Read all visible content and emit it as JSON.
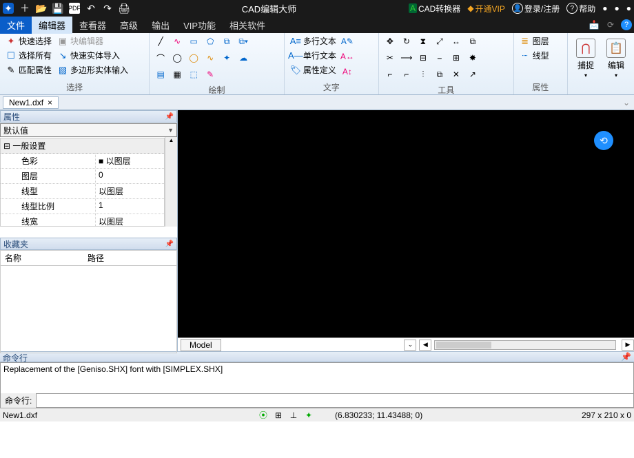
{
  "titlebar": {
    "appicon": "⟠",
    "title": "CAD编辑大师",
    "converter": "CAD转换器",
    "vip": "开通VIP",
    "login": "登录/注册",
    "help": "帮助"
  },
  "menus": {
    "file": "文件",
    "editor": "编辑器",
    "viewer": "查看器",
    "advanced": "高级",
    "output": "输出",
    "vip": "VIP功能",
    "related": "相关软件"
  },
  "ribbon": {
    "select": {
      "label": "选择",
      "quick": "快速选择",
      "blockedit": "块编辑器",
      "all": "选择所有",
      "quickimport": "快速实体导入",
      "match": "匹配属性",
      "polyinput": "多边形实体输入"
    },
    "draw": {
      "label": "绘制"
    },
    "text": {
      "label": "文字",
      "multi": "多行文本",
      "single": "单行文本",
      "attrdef": "属性定义"
    },
    "tools": {
      "label": "工具"
    },
    "props": {
      "label": "属性",
      "layer": "图层",
      "linetype": "线型"
    },
    "snap": "捕捉",
    "edit": "编辑"
  },
  "filetab": {
    "name": "New1.dxf",
    "close": "×"
  },
  "prop": {
    "title": "属性",
    "default": "默认值",
    "general": "一般设置",
    "rows": {
      "color": "色彩",
      "colorv": "以图层",
      "layer": "图层",
      "layerv": "0",
      "ltype": "线型",
      "ltypev": "以图层",
      "lscale": "线型比例",
      "lscalev": "1",
      "lweight": "线宽",
      "lweightv": "以图层"
    }
  },
  "fav": {
    "title": "收藏夹",
    "name": "名称",
    "path": "路径"
  },
  "model": "Model",
  "cmd": {
    "title": "命令行",
    "out": "Replacement of the [Geniso.SHX] font with [SIMPLEX.SHX]",
    "prompt": "命令行:"
  },
  "status": {
    "file": "New1.dxf",
    "coords": "(6.830233; 11.43488; 0)",
    "dims": "297 x 210 x 0"
  }
}
